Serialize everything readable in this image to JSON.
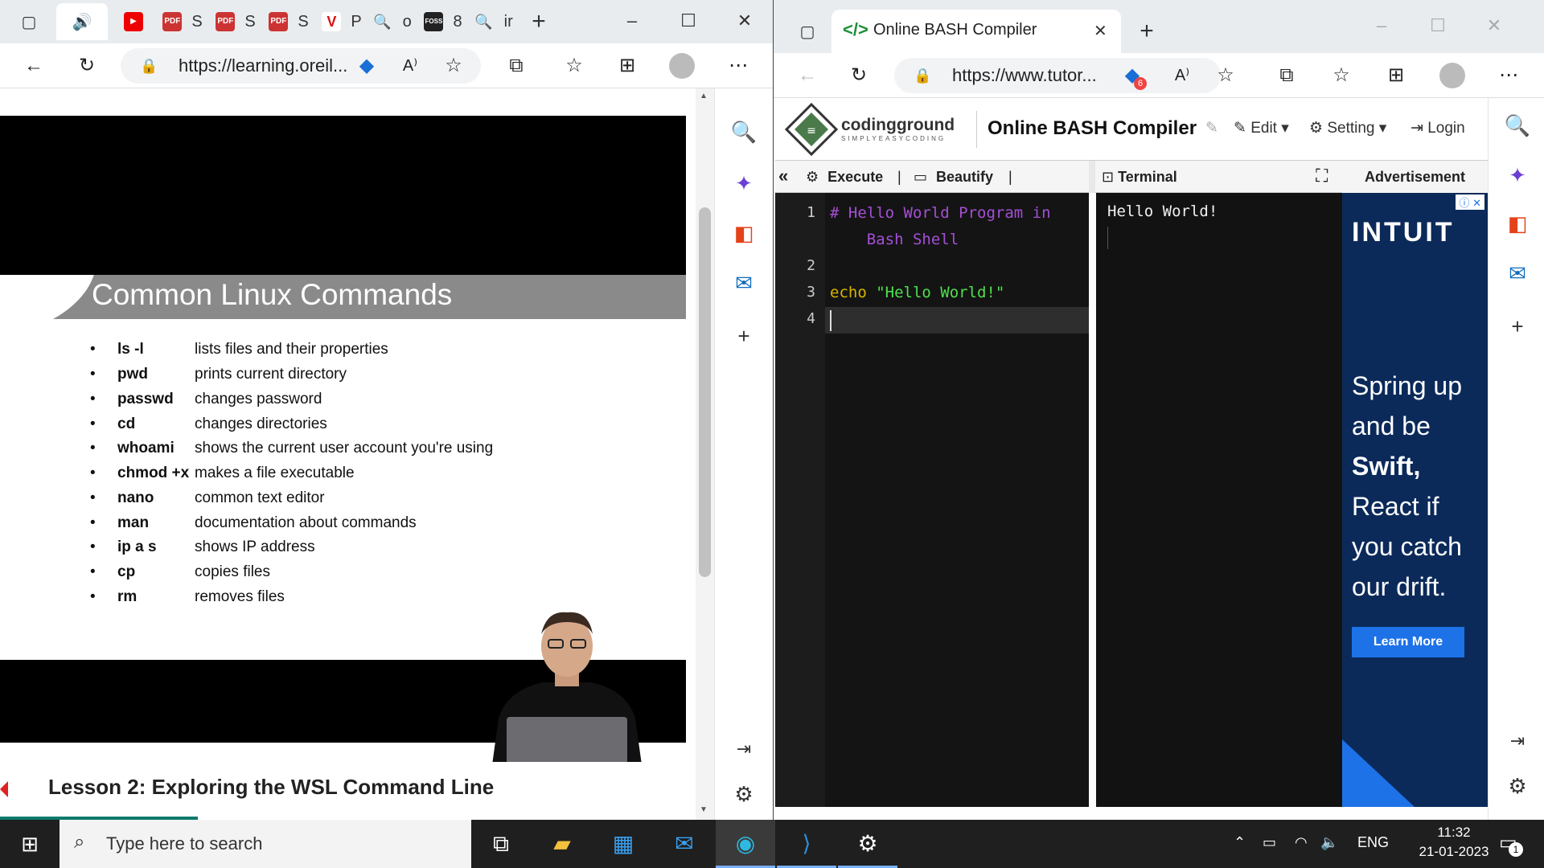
{
  "left_browser": {
    "tabs": [
      {
        "icon": "speaker-icon",
        "label": ""
      },
      {
        "icon": "youtube-icon",
        "label": ""
      },
      {
        "icon": "pdf-icon",
        "label": "S"
      },
      {
        "icon": "pdf-icon",
        "label": "S"
      },
      {
        "icon": "pdf-icon",
        "label": "S"
      },
      {
        "icon": "v-logo-icon",
        "label": "P"
      },
      {
        "icon": "search-icon",
        "label": "o"
      },
      {
        "icon": "fossmint-icon",
        "label": "8"
      },
      {
        "icon": "search-icon",
        "label": "ir"
      }
    ],
    "url": "https://learning.oreil...",
    "slide": {
      "title": "Common Linux Commands",
      "commands": [
        {
          "cmd": "ls -l",
          "desc": "lists files and their properties"
        },
        {
          "cmd": "pwd",
          "desc": "prints current directory"
        },
        {
          "cmd": "passwd",
          "desc": "changes password"
        },
        {
          "cmd": "cd",
          "desc": "changes directories"
        },
        {
          "cmd": "whoami",
          "desc": "shows the current user account you're using"
        },
        {
          "cmd": "chmod +x",
          "desc": "makes a file executable"
        },
        {
          "cmd": "nano",
          "desc": "common text editor"
        },
        {
          "cmd": "man",
          "desc": "documentation about commands"
        },
        {
          "cmd": "ip a s",
          "desc": "shows IP address"
        },
        {
          "cmd": "cp",
          "desc": "copies files"
        },
        {
          "cmd": "rm",
          "desc": "removes files"
        }
      ]
    },
    "lesson_title": "Lesson 2: Exploring the WSL Command Line"
  },
  "right_browser": {
    "tab_title": "Online BASH Compiler",
    "url": "https://www.tutor...",
    "tracker_badge": "6",
    "brand": "codingground",
    "brand_sub": "SIMPLYEASYCODING",
    "page_title": "Online BASH Compiler",
    "menu": {
      "edit": "Edit",
      "setting": "Setting",
      "login": "Login"
    },
    "bar": {
      "execute": "Execute",
      "beautify": "Beautify",
      "terminal": "Terminal",
      "advertisement": "Advertisement"
    },
    "code_lines": [
      {
        "num": "1",
        "text": "# Hello World Program in"
      },
      {
        "num": "",
        "text": "    Bash Shell"
      },
      {
        "num": "2",
        "text": ""
      },
      {
        "num": "3",
        "text": "echo \"Hello World!\""
      },
      {
        "num": "4",
        "text": ""
      }
    ],
    "terminal_output": "Hello World!",
    "ad": {
      "brand": "INTUIT",
      "lines": [
        "Spring up",
        "and be",
        "Swift,",
        "React if",
        "you catch",
        "our drift."
      ],
      "cta": "Learn More"
    }
  },
  "taskbar": {
    "search_placeholder": "Type here to search",
    "language": "ENG",
    "time": "11:32",
    "date": "21-01-2023",
    "notification_count": "1"
  },
  "colors": {
    "comment": "#a54fd6",
    "keyword": "#d8b400",
    "string": "#4fe04f",
    "edge_blue": "#0f6cbd",
    "ad_bg": "#0b2a5a"
  }
}
